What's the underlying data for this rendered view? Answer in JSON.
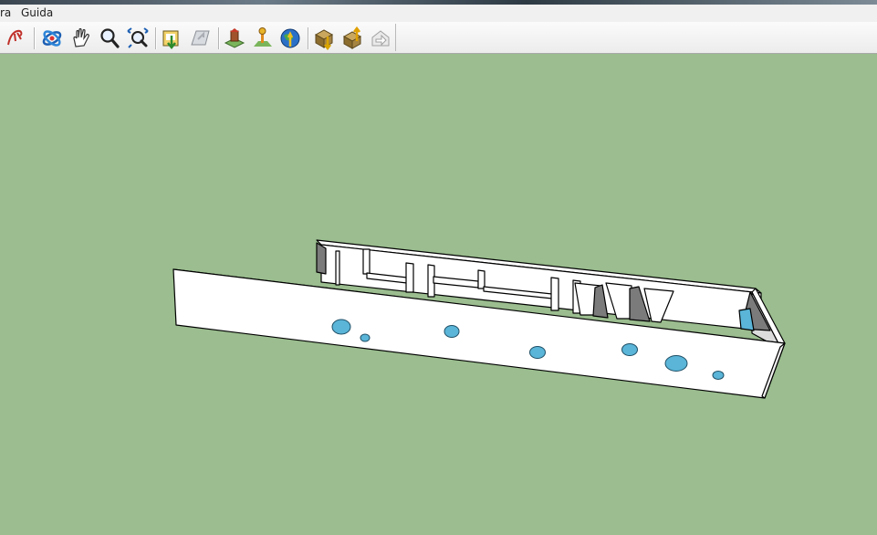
{
  "menu": {
    "items": [
      {
        "label": "ra"
      },
      {
        "label": "Guida"
      }
    ]
  },
  "toolbar": {
    "tools": [
      "freehand-icon",
      "orbit-icon",
      "pan-icon",
      "zoom-icon",
      "zoom-extents-icon",
      "get-models-icon",
      "share-model-icon",
      "place-component-icon",
      "add-location-icon",
      "google-earth-icon",
      "get-photo-textures-icon",
      "upload-icon",
      "preview-icon"
    ]
  },
  "viewport": {
    "background": "#9bbd8f",
    "model": "3d-box-with-partitions-and-holes"
  },
  "colors": {
    "face": "#ffffff",
    "shadow": "#7b7b7b",
    "hole": "#5ab5d8",
    "edge": "#000000"
  }
}
